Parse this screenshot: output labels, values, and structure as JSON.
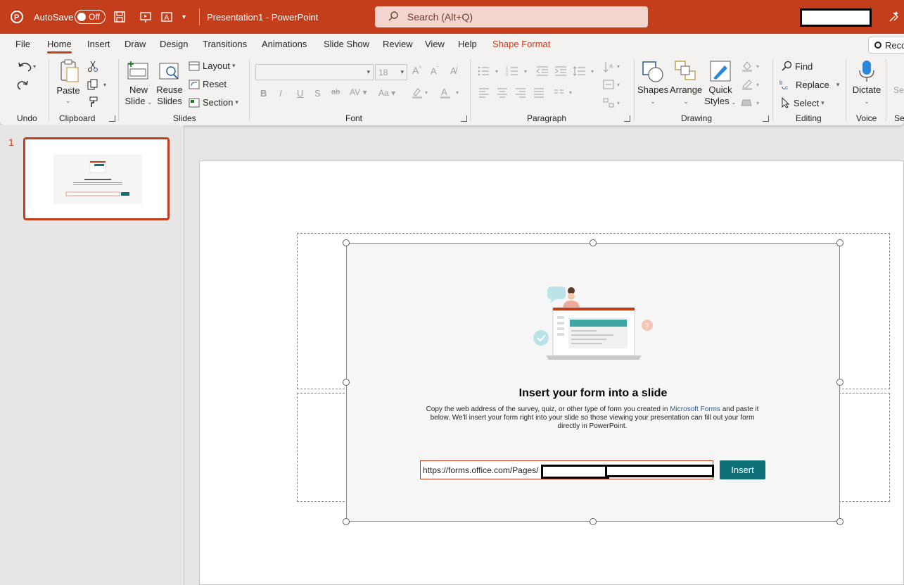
{
  "titlebar": {
    "autosave_label": "AutoSave",
    "autosave_state": "Off",
    "document_title": "Presentation1  -  PowerPoint",
    "search_placeholder": "Search (Alt+Q)"
  },
  "tabs": [
    "File",
    "Home",
    "Insert",
    "Draw",
    "Design",
    "Transitions",
    "Animations",
    "Slide Show",
    "Review",
    "View",
    "Help",
    "Shape Format"
  ],
  "active_tab": "Home",
  "record_button": "Reco",
  "ribbon": {
    "groups": {
      "undo": "Undo",
      "clipboard": "Clipboard",
      "slides": "Slides",
      "font": "Font",
      "paragraph": "Paragraph",
      "drawing": "Drawing",
      "editing": "Editing",
      "voice": "Voice",
      "sensitivity": "Se"
    },
    "paste": "Paste",
    "new_slide": [
      "New",
      "Slide"
    ],
    "reuse_slides": [
      "Reuse",
      "Slides"
    ],
    "layout": "Layout",
    "reset": "Reset",
    "section": "Section",
    "font_size": "18",
    "shapes": "Shapes",
    "arrange": "Arrange",
    "quick_styles": [
      "Quick",
      "Styles"
    ],
    "find": "Find",
    "replace": "Replace",
    "select": "Select",
    "dictate": "Dictate",
    "sensitivity": "Sen"
  },
  "slide_panel": {
    "slide_number": "1"
  },
  "form_embed": {
    "title": "Insert your form into a slide",
    "description_before": "Copy the web address of the survey, quiz, or other type of form you created in ",
    "description_link": "Microsoft Forms",
    "description_after": " and paste it below. We'll insert your form right into your slide so those viewing your presentation can fill out your form directly in PowerPoint.",
    "url_value": "https://forms.office.com/Pages/",
    "insert_label": "Insert"
  },
  "colors": {
    "brand": "#c43e1c",
    "insert_button": "#0f7079",
    "link": "#2b5797"
  }
}
